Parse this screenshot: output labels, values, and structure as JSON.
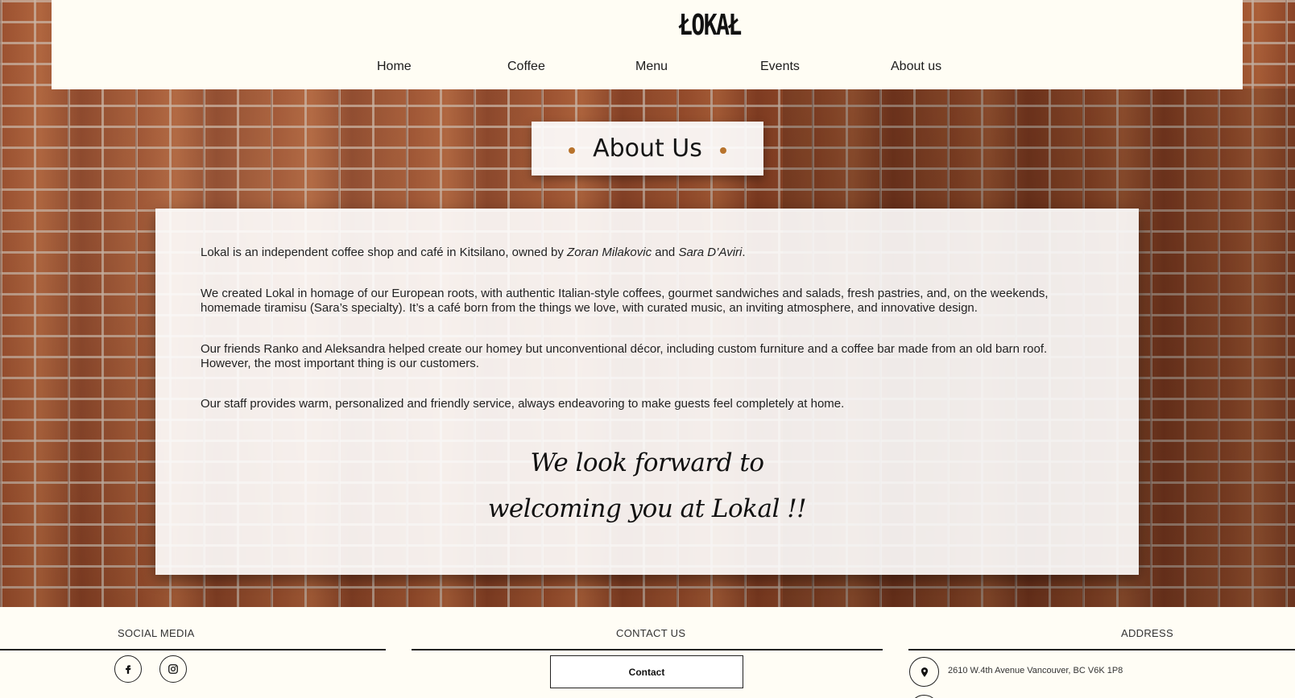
{
  "brand": {
    "logo_text": "ŁOKAŁ"
  },
  "nav": {
    "items": [
      {
        "label": "Home"
      },
      {
        "label": "Coffee"
      },
      {
        "label": "Menu"
      },
      {
        "label": "Events"
      },
      {
        "label": "About us"
      }
    ]
  },
  "page": {
    "title": "About Us"
  },
  "content": {
    "p1": {
      "prefix": "Lokal is an independent coffee shop and café in Kitsilano, owned by ",
      "owner1": "Zoran Milakovic",
      "and": " and ",
      "owner2": "Sara D’Aviri",
      "suffix": "."
    },
    "p2": "We created Lokal in homage of our European roots, with authentic Italian-style coffees, gourmet sandwiches and salads, fresh pastries, and, on the weekends, homemade tiramisu (Sara’s specialty). It’s a café born from the things we love, with curated music, an inviting atmosphere, and innovative design.",
    "p3": "Our friends Ranko and Aleksandra helped create our homey but unconventional décor, including custom furniture and a coffee bar made from an old barn roof. However, the most important thing is our customers.",
    "p4": "Our staff provides warm, personalized and friendly service, always endeavoring to make guests feel completely at home.",
    "closing_line1": "We look forward to",
    "closing_line2": "welcoming you at Lokal !!"
  },
  "footer": {
    "social_heading": "SOCIAL MEDIA",
    "contact_heading": "CONTACT US",
    "contact_button": "Contact",
    "address_heading": "ADDRESS",
    "address": "2610 W.4th Avenue Vancouver, BC V6K 1P8",
    "social_icons": [
      "facebook-icon",
      "instagram-icon"
    ]
  },
  "colors": {
    "accent_dot": "#b8732c",
    "header_bg": "#fffdf4"
  }
}
